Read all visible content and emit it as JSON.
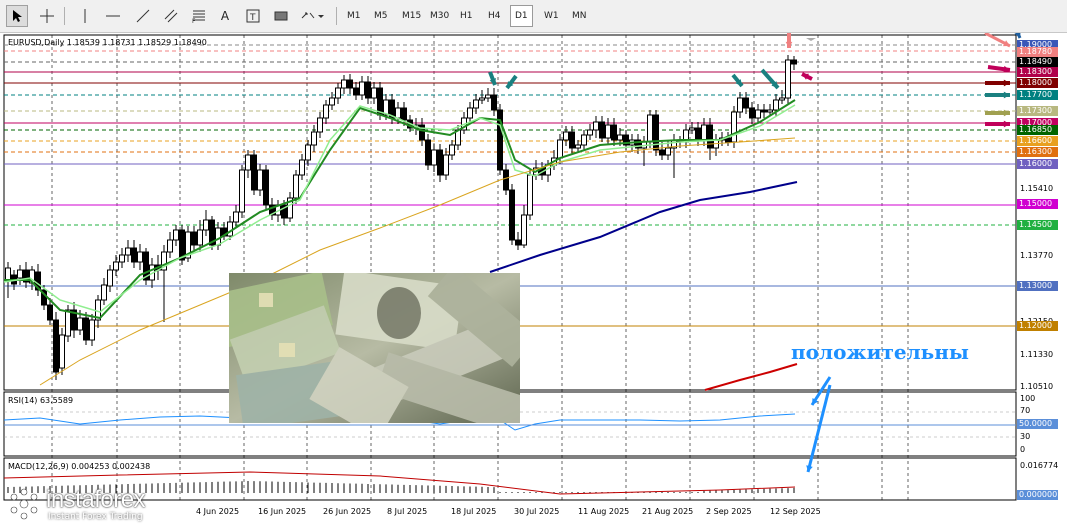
{
  "toolbar": {
    "timeframes": [
      "M1",
      "M5",
      "M15",
      "M30",
      "H1",
      "H4",
      "D1",
      "W1",
      "MN"
    ],
    "active_timeframe": "D1",
    "text_tool_label": "A"
  },
  "chart": {
    "header": "EURUSD,Daily  1.18539 1.18731 1.18529 1.18490",
    "rsi_label": "RSI(14) 63.5589",
    "macd_label": "MACD(12,26,9) 0.004253 0.002438",
    "annotation_text": "положительны",
    "axis_prices": [
      "1.15410",
      "1.13770",
      "1.12150",
      "1.11330",
      "1.10510"
    ],
    "level_labels": [
      {
        "text": "1.19000",
        "color": "#3a57b8"
      },
      {
        "text": "1.18780",
        "color": "#f08080"
      },
      {
        "text": "1.18490",
        "color": "#000000"
      },
      {
        "text": "1.18300",
        "color": "#b0004a"
      },
      {
        "text": "1.18000",
        "color": "#800000"
      },
      {
        "text": "1.17700",
        "color": "#008080"
      },
      {
        "text": "1.17300",
        "color": "#b8b880"
      },
      {
        "text": "1.17000",
        "color": "#c00060"
      },
      {
        "text": "1.16850",
        "color": "#006400"
      },
      {
        "text": "1.16600",
        "color": "#e8a020"
      },
      {
        "text": "1.16300",
        "color": "#e07010"
      },
      {
        "text": "1.16000",
        "color": "#7060c0"
      },
      {
        "text": "1.15000",
        "color": "#d000d0"
      },
      {
        "text": "1.14500",
        "color": "#20b040"
      },
      {
        "text": "1.13000",
        "color": "#5070c0"
      },
      {
        "text": "1.12000",
        "color": "#c08000"
      }
    ],
    "rsi_axis": [
      "100",
      "70",
      "50.0000",
      "30",
      "0"
    ],
    "macd_axis": [
      "0.016774",
      "0.000000"
    ],
    "dates": [
      "4 Jun 2025",
      "16 Jun 2025",
      "26 Jun 2025",
      "8 Jul 2025",
      "18 Jul 2025",
      "30 Jul 2025",
      "11 Aug 2025",
      "21 Aug 2025",
      "2 Sep 2025",
      "12 Sep 2025"
    ],
    "colors": {
      "ema_fast": "#90ee90",
      "ema_mid": "#228b22",
      "ma_slow": "#daa520",
      "ma_long": "#00008b",
      "ma_red": "#cc0000",
      "rsi_line": "#1e90ff"
    }
  },
  "branding": {
    "logo_name": "instaforex",
    "logo_tagline": "Instant Forex Trading"
  }
}
